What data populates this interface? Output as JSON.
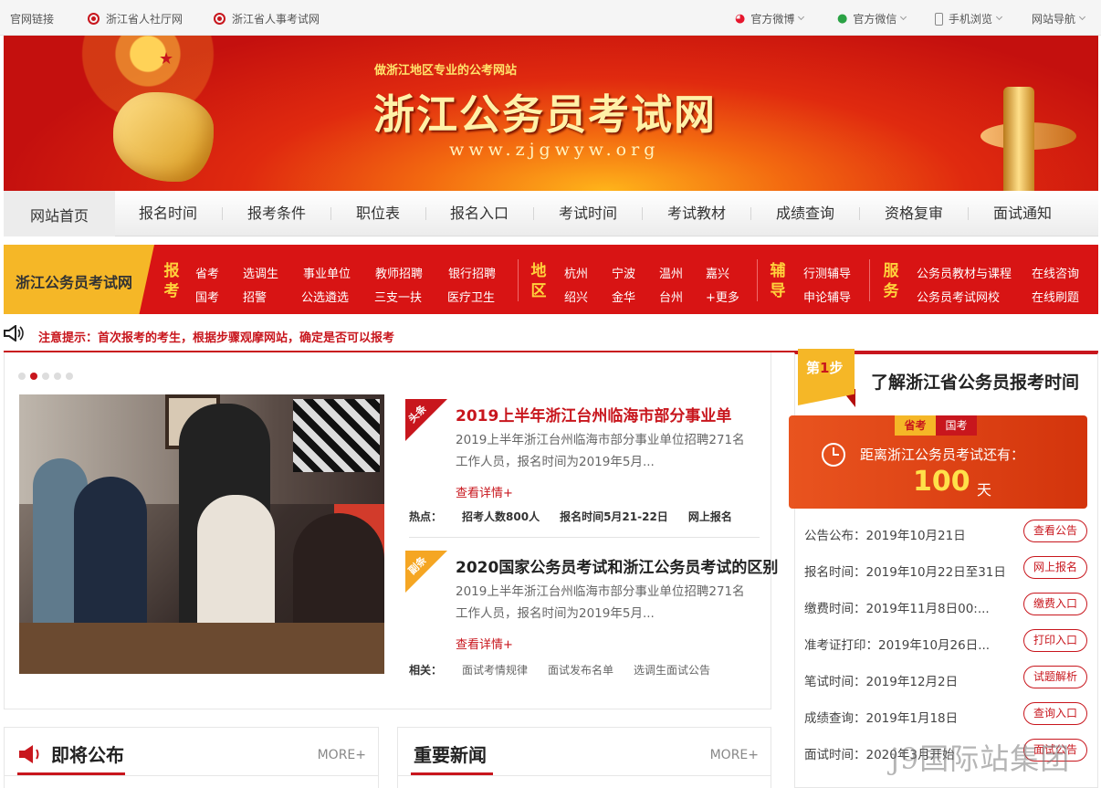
{
  "topbar": {
    "links_label": "官网链接",
    "left_links": [
      "浙江省人社厅网",
      "浙江省人事考试网"
    ],
    "right_links": [
      "官方微博",
      "官方微信",
      "手机浏览",
      "网站导航"
    ]
  },
  "banner": {
    "slogan": "做浙江地区专业的公考网站",
    "title": "浙江公务员考试网",
    "url": "www.zjgwyw.org"
  },
  "nav": [
    "网站首页",
    "报名时间",
    "报考条件",
    "职位表",
    "报名入口",
    "考试时间",
    "考试教材",
    "成绩查询",
    "资格复审",
    "面试通知"
  ],
  "quick": {
    "tag": "浙江公务员考试网",
    "groups": [
      {
        "cat": "报考",
        "links": [
          "省考",
          "选调生",
          "事业单位",
          "教师招聘",
          "银行招聘",
          "国考",
          "招警",
          "公选遴选",
          "三支一扶",
          "医疗卫生"
        ]
      },
      {
        "cat": "地区",
        "links": [
          "杭州",
          "宁波",
          "温州",
          "嘉兴",
          "绍兴",
          "金华",
          "台州",
          "+更多"
        ]
      },
      {
        "cat": "辅导",
        "links": [
          "行测辅导",
          "申论辅导"
        ]
      },
      {
        "cat": "服务",
        "links": [
          "公务员教材与课程",
          "在线咨询",
          "公务员考试网校",
          "在线刷题"
        ]
      }
    ]
  },
  "notice": "注意提示：首次报考的考生，根据步骤观摩网站，确定是否可以报考",
  "headline": {
    "badge": "头条",
    "title": "2019上半年浙江台州临海市部分事业单",
    "summary": "2019上半年浙江台州临海市部分事业单位招聘271名工作人员，报名时间为2019年5月...",
    "more": "查看详情+",
    "hot_label": "热点：",
    "hot_items": [
      "招考人数800人",
      "报名时间5月21-22日",
      "网上报名"
    ]
  },
  "sub": {
    "badge": "副条",
    "title": "2020国家公务员考试和浙江公务员考试的区别",
    "summary": "2019上半年浙江台州临海市部分事业单位招聘271名工作人员，报名时间为2019年5月...",
    "more": "查看详情+",
    "rel_label": "相关：",
    "rel_items": [
      "面试考情规律",
      "面试发布名单",
      "选调生面试公告"
    ]
  },
  "boxes": [
    {
      "title": "即将公布",
      "more": "MORE+"
    },
    {
      "title": "重要新闻",
      "more": "MORE+"
    }
  ],
  "right": {
    "step": {
      "prefix": "第",
      "num": "1",
      "suffix": "步"
    },
    "title": "了解浙江省公务员报考时间",
    "tabs": [
      "省考",
      "国考"
    ],
    "countdown_text": "距离浙江公务员考试还有：",
    "countdown_num": "100",
    "countdown_unit": "天",
    "schedule": [
      {
        "label": "公告公布：2019年10月21日",
        "btn": "查看公告"
      },
      {
        "label": "报名时间：2019年10月22日至31日",
        "btn": "网上报名"
      },
      {
        "label": "缴费时间：2019年11月8日00:...",
        "btn": "缴费入口"
      },
      {
        "label": "准考证打印：2019年10月26日...",
        "btn": "打印入口"
      },
      {
        "label": "笔试时间：2019年12月2日",
        "btn": "试题解析"
      },
      {
        "label": "成绩查询：2019年1月18日",
        "btn": "查询入口"
      },
      {
        "label": "面试时间：2020年3月开始",
        "btn": "面试公告"
      }
    ]
  },
  "watermark": "j9国际站集团",
  "colors": {
    "brand_red": "#c8161d",
    "bar_red": "#d81414",
    "accent_yellow": "#f5b727"
  }
}
